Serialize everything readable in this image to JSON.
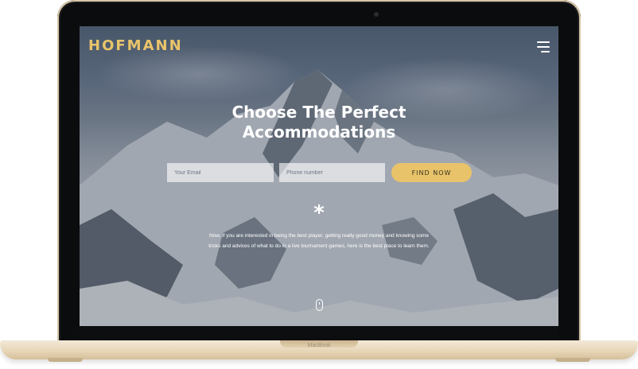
{
  "device": {
    "model_label": "MacBook",
    "frame_color": "#e7d6b8"
  },
  "site": {
    "brand": "HOFMANN",
    "brand_color": "#e9c46a",
    "menu_icon": "hamburger-icon",
    "hero": {
      "title_line1": "Choose The Perfect",
      "title_line2": "Accommodations"
    },
    "form": {
      "email_placeholder": "Your Email",
      "phone_placeholder": "Phone number",
      "submit_label": "FIND NOW",
      "accent_color": "#e8c36a"
    },
    "divider_symbol": "*",
    "description": "Now, if you are interested in being the best player, getting really good money and knowing some tricks and advices of what to do in a live tournament games, here is the best place to learn them.",
    "scroll_icon": "scroll-mouse-icon"
  }
}
